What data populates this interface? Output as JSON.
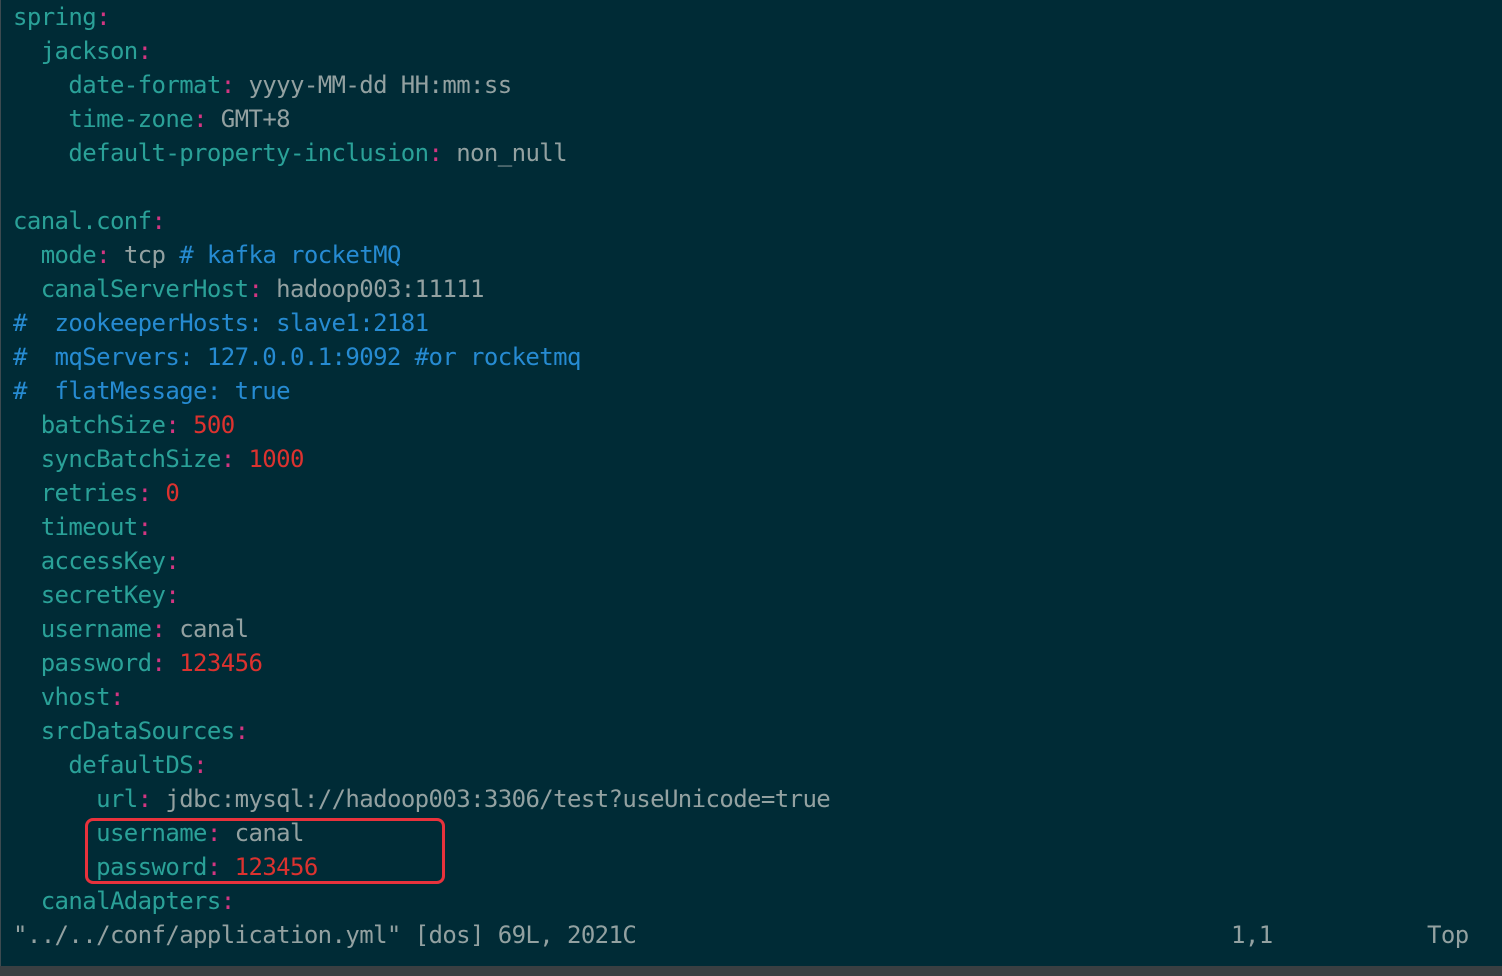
{
  "lines": [
    {
      "indent": "",
      "key": "spring",
      "sep": ":",
      "value": "",
      "type": "kv"
    },
    {
      "indent": "  ",
      "key": "jackson",
      "sep": ":",
      "value": "",
      "type": "kv"
    },
    {
      "indent": "    ",
      "key": "date-format",
      "sep": ":",
      "value": " yyyy-MM-dd HH:mm:ss",
      "type": "kv"
    },
    {
      "indent": "    ",
      "key": "time-zone",
      "sep": ":",
      "value": " GMT+8",
      "type": "kv"
    },
    {
      "indent": "    ",
      "key": "default-property-inclusion",
      "sep": ":",
      "value": " non_null",
      "type": "kv"
    },
    {
      "indent": "",
      "key": "",
      "sep": "",
      "value": "",
      "type": "blank"
    },
    {
      "indent": "",
      "key": "canal.conf",
      "sep": ":",
      "value": "",
      "type": "kv"
    },
    {
      "indent": "  ",
      "key": "mode",
      "sep": ":",
      "value": " tcp ",
      "comment": "# kafka rocketMQ",
      "type": "kv"
    },
    {
      "indent": "  ",
      "key": "canalServerHost",
      "sep": ":",
      "value": " hadoop003:11111",
      "type": "kv"
    },
    {
      "indent": "",
      "key": "",
      "sep": "",
      "value": "",
      "comment": "#  zookeeperHosts: slave1:2181",
      "type": "comment"
    },
    {
      "indent": "",
      "key": "",
      "sep": "",
      "value": "",
      "comment": "#  mqServers: 127.0.0.1:9092 #or rocketmq",
      "type": "comment"
    },
    {
      "indent": "",
      "key": "",
      "sep": "",
      "value": "",
      "comment": "#  flatMessage: true",
      "type": "comment"
    },
    {
      "indent": "  ",
      "key": "batchSize",
      "sep": ":",
      "value": "",
      "num": " 500",
      "type": "kv"
    },
    {
      "indent": "  ",
      "key": "syncBatchSize",
      "sep": ":",
      "value": "",
      "num": " 1000",
      "type": "kv"
    },
    {
      "indent": "  ",
      "key": "retries",
      "sep": ":",
      "value": "",
      "num": " 0",
      "type": "kv"
    },
    {
      "indent": "  ",
      "key": "timeout",
      "sep": ":",
      "value": "",
      "type": "kv"
    },
    {
      "indent": "  ",
      "key": "accessKey",
      "sep": ":",
      "value": "",
      "type": "kv"
    },
    {
      "indent": "  ",
      "key": "secretKey",
      "sep": ":",
      "value": "",
      "type": "kv"
    },
    {
      "indent": "  ",
      "key": "username",
      "sep": ":",
      "value": " canal",
      "type": "kv"
    },
    {
      "indent": "  ",
      "key": "password",
      "sep": ":",
      "value": "",
      "num": " 123456",
      "type": "kv"
    },
    {
      "indent": "  ",
      "key": "vhost",
      "sep": ":",
      "value": "",
      "type": "kv"
    },
    {
      "indent": "  ",
      "key": "srcDataSources",
      "sep": ":",
      "value": "",
      "type": "kv"
    },
    {
      "indent": "    ",
      "key": "defaultDS",
      "sep": ":",
      "value": "",
      "type": "kv"
    },
    {
      "indent": "      ",
      "key": "url",
      "sep": ":",
      "value": " jdbc:mysql://hadoop003:3306/test?useUnicode=true",
      "type": "kv"
    },
    {
      "indent": "      ",
      "key": "username",
      "sep": ":",
      "value": " canal",
      "type": "kv"
    },
    {
      "indent": "      ",
      "key": "password",
      "sep": ":",
      "value": "",
      "num": " 123456",
      "type": "kv"
    },
    {
      "indent": "  ",
      "key": "canalAdapters",
      "sep": ":",
      "value": "",
      "type": "kv"
    }
  ],
  "status": {
    "file_info": "\"../../conf/application.yml\" [dos] 69L, 2021C",
    "cursor_pos": "1,1",
    "scroll": "Top"
  },
  "colors": {
    "background": "#002b36",
    "key": "#2aa198",
    "punct": "#d33682",
    "number": "#dc322f",
    "comment": "#268bd2",
    "text": "#93a1a1",
    "highlight": "#e8323c"
  }
}
